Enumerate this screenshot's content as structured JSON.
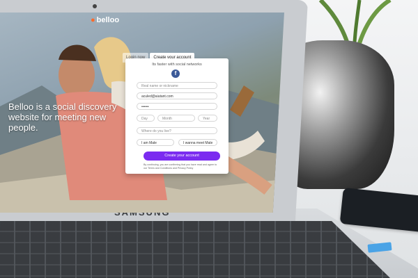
{
  "hero": {
    "logo_text": "belloo",
    "tagline": "Belloo is a social discovery website for meeting new people."
  },
  "signup": {
    "tabs": [
      "Login now",
      "Create your account"
    ],
    "subtitle": "Its faster with social networks",
    "facebook_icon": "f",
    "fields": {
      "name_placeholder": "Real name or nickname",
      "email_value": "aculed@aiutant.com",
      "password_value": "••••••",
      "day_placeholder": "Day",
      "month_placeholder": "Month",
      "year_placeholder": "Year",
      "location_placeholder": "Where do you live?",
      "gender_value": "I am Male",
      "looking_for_value": "I wanna meet Male"
    },
    "submit_label": "Create your account",
    "terms_text": "By continuing, you are confirming that you have read and agree to our Terms and Conditions and Privacy Policy"
  },
  "device": {
    "brand": "SAMSUNG"
  },
  "colors": {
    "accent": "#7b2cf0",
    "logo_mark": "#ff6a2a",
    "facebook": "#3b5998"
  }
}
